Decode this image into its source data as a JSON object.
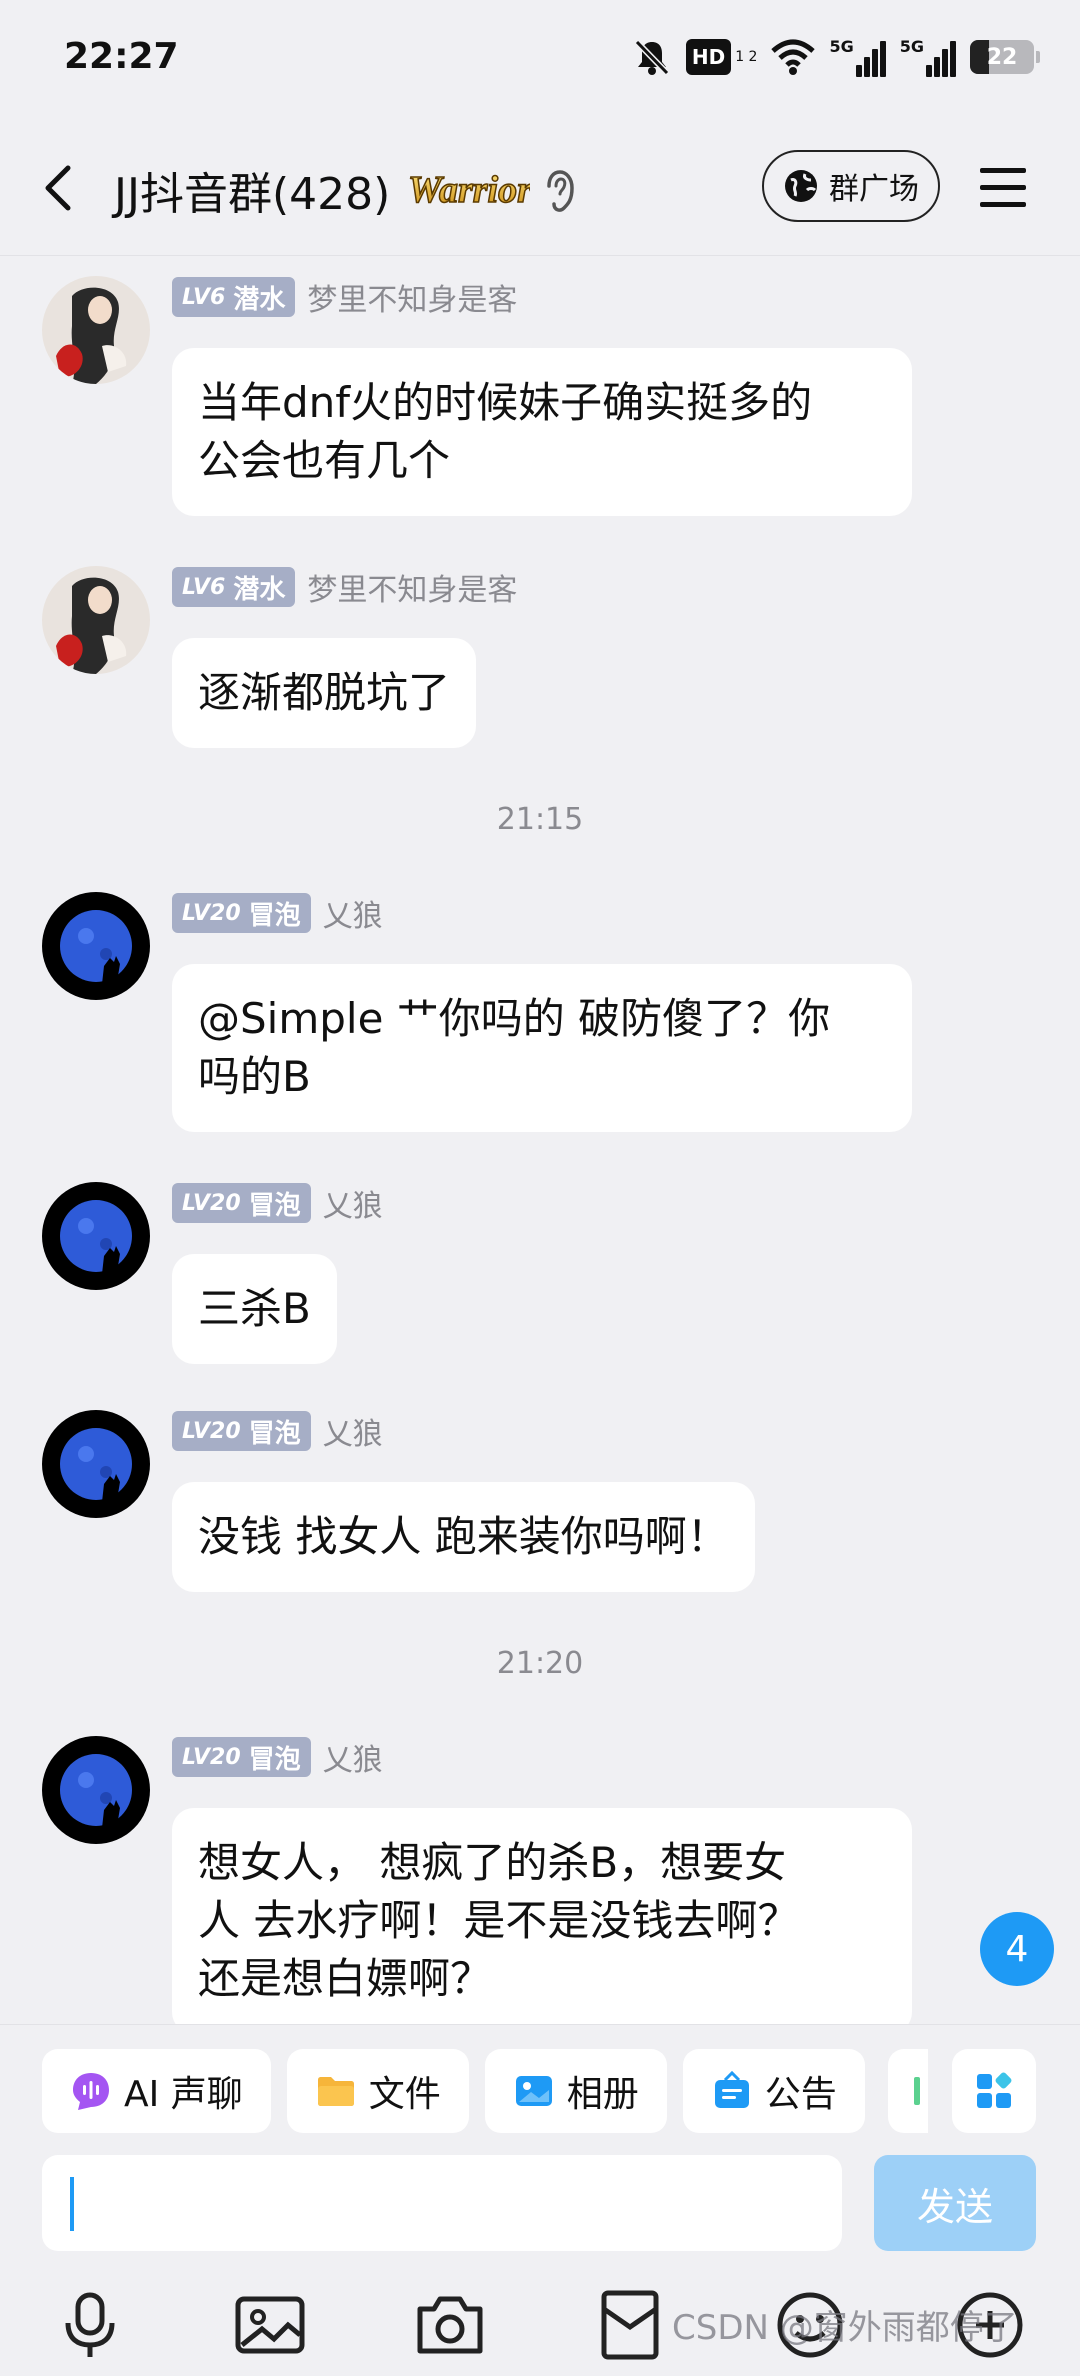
{
  "status_bar": {
    "time": "22:27",
    "hd_label": "HD",
    "hd_sub": "1 2",
    "signal1_label": "5G",
    "signal2_label": "5G",
    "battery": "22"
  },
  "header": {
    "title": "JJ抖音群(428)",
    "square_button_label": "群广场"
  },
  "messages": [
    {
      "avatar": "avatar-girl",
      "level": "LV6",
      "rank": "潜水",
      "sender": "梦里不知身是客",
      "lines": [
        "当年dnf火的时候妹子确实挺多的",
        "公会也有几个"
      ]
    },
    {
      "avatar": "avatar-girl",
      "level": "LV6",
      "rank": "潜水",
      "sender": "梦里不知身是客",
      "lines": [
        "逐渐都脱坑了"
      ]
    },
    {
      "timestamp": "21:15"
    },
    {
      "avatar": "avatar-moon-wolf",
      "level": "LV20",
      "rank": "冒泡",
      "sender": "乂狼",
      "lines": [
        "@Simple 艹你吗的 破防傻了？你",
        "吗的B"
      ]
    },
    {
      "avatar": "avatar-moon-wolf",
      "level": "LV20",
      "rank": "冒泡",
      "sender": "乂狼",
      "lines": [
        "三杀B"
      ]
    },
    {
      "avatar": "avatar-moon-wolf",
      "level": "LV20",
      "rank": "冒泡",
      "sender": "乂狼",
      "lines": [
        "没钱 找女人 跑来装你吗啊！"
      ]
    },
    {
      "timestamp": "21:20"
    },
    {
      "avatar": "avatar-moon-wolf",
      "level": "LV20",
      "rank": "冒泡",
      "sender": "乂狼",
      "lines": [
        "想女人， 想疯了的杀B，想要女",
        "人 去水疗啊！是不是没钱去啊？",
        "还是想白嫖啊？"
      ]
    }
  ],
  "unread_count": "4",
  "quick_actions": [
    {
      "label": "AI 声聊",
      "icon": "ai-voice-icon",
      "color": "#A455F2"
    },
    {
      "label": "文件",
      "icon": "folder-icon",
      "color": "#F6B53A"
    },
    {
      "label": "相册",
      "icon": "album-icon",
      "color": "#1E9AF5"
    },
    {
      "label": "公告",
      "icon": "announcement-icon",
      "color": "#1E9AF5"
    }
  ],
  "composer": {
    "send_label": "发送"
  },
  "toolbar": [
    "mic-icon",
    "image-icon",
    "camera-icon",
    "red-packet-icon",
    "emoji-icon",
    "more-icon"
  ],
  "watermark": "CSDN @窗外雨都停了",
  "colors": {
    "accent": "#1E9AF5",
    "background": "#F0F0F3",
    "level_badge": "#A6AEC6",
    "send_disabled": "#9DD0F7"
  }
}
